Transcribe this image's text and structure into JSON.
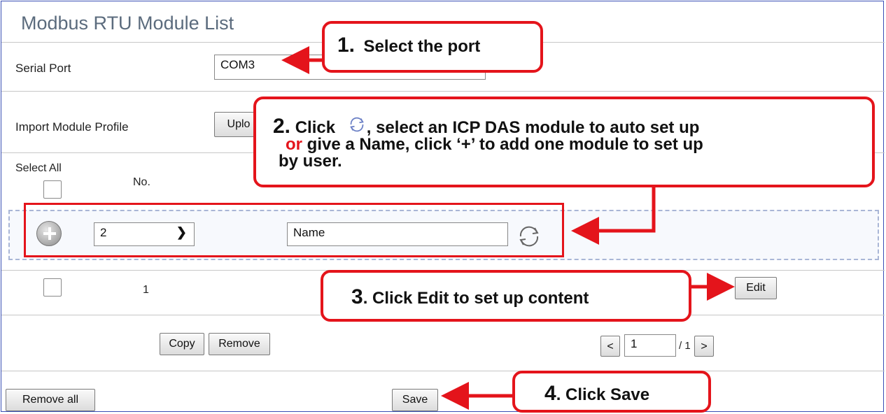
{
  "title": "Modbus RTU Module List",
  "serial_port": {
    "label": "Serial Port",
    "value": "COM3"
  },
  "import_profile": {
    "label": "Import Module Profile",
    "upload_label": "Uplo"
  },
  "table": {
    "select_all_label": "Select All",
    "no_header": "No.",
    "new_row": {
      "number_value": "2",
      "name_value": "Name"
    },
    "rows": [
      {
        "no": "1",
        "edit_label": "Edit"
      }
    ]
  },
  "actions": {
    "copy_label": "Copy",
    "remove_label": "Remove",
    "remove_all_label": "Remove all",
    "save_label": "Save"
  },
  "pager": {
    "prev_label": "<",
    "page_value": "1",
    "total_label": "/ 1",
    "next_label": ">"
  },
  "callouts": {
    "c1_num": "1.",
    "c1_text": "Select the port",
    "c2_num": "2.",
    "c2_click": "Click",
    "c2_text1": ", select an ICP DAS module to auto set up",
    "c2_or": "or",
    "c2_text2": " give a Name, click ‘+’ to add one module to set up",
    "c2_text3": "by user.",
    "c3_num": "3",
    "c3_text": ". Click Edit to set up content",
    "c4_num": "4",
    "c4_text": ". Click Save"
  },
  "colors": {
    "accent": "#e4141b",
    "title": "#5b6b7d",
    "dashed_border": "#a9b6d6"
  }
}
